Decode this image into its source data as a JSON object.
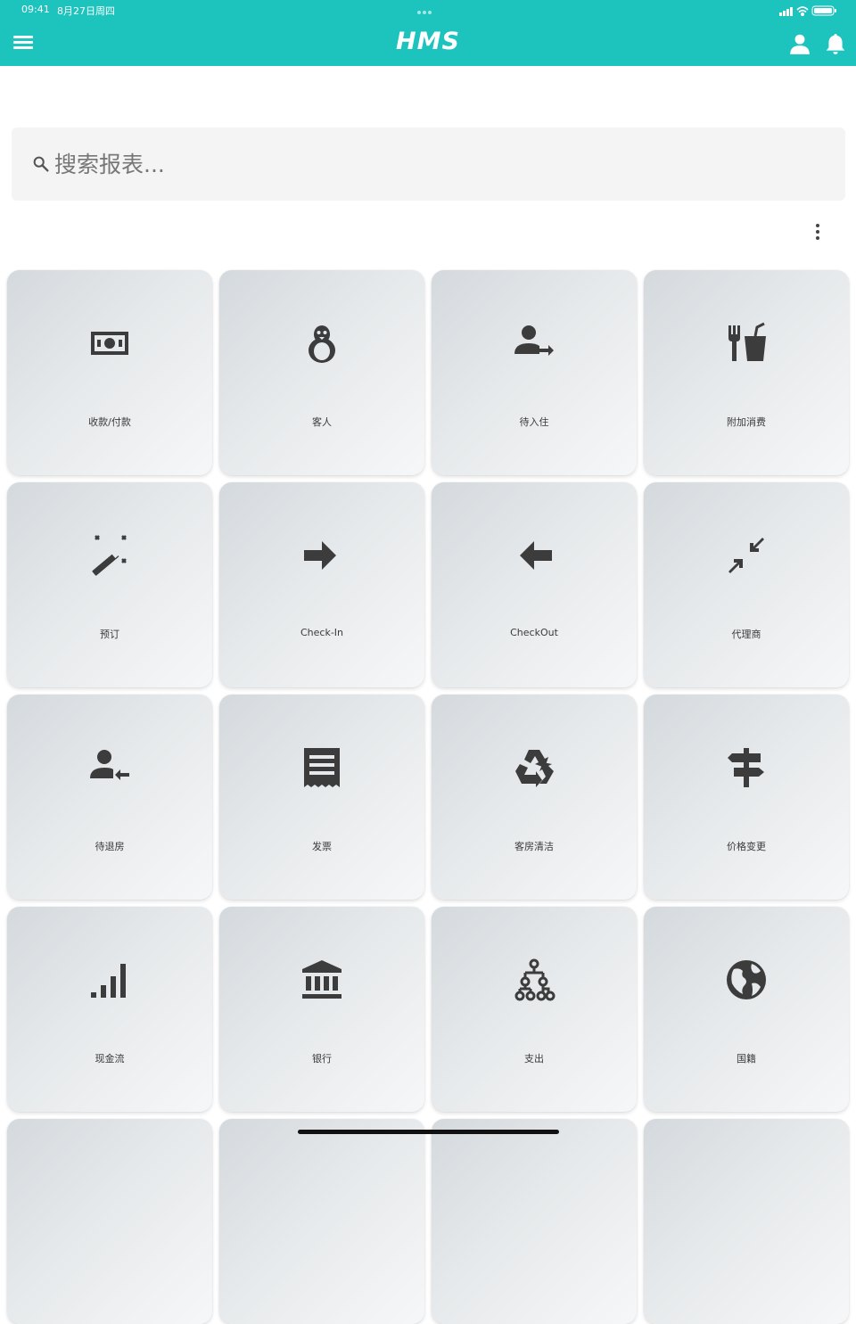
{
  "status_bar": {
    "time": "09:41",
    "date": "8月27日周四"
  },
  "app_bar": {
    "title": "HMS"
  },
  "search": {
    "placeholder": "搜索报表..."
  },
  "tiles": [
    {
      "label": "收款/付款",
      "icon": "money-icon"
    },
    {
      "label": "客人",
      "icon": "penguin-icon"
    },
    {
      "label": "待入住",
      "icon": "person-arrow-right-icon"
    },
    {
      "label": "附加消费",
      "icon": "food-drink-icon"
    },
    {
      "label": "预订",
      "icon": "magic-wand-icon"
    },
    {
      "label": "Check-In",
      "icon": "arrow-right-icon"
    },
    {
      "label": "CheckOut",
      "icon": "arrow-left-icon"
    },
    {
      "label": "代理商",
      "icon": "compress-arrows-icon"
    },
    {
      "label": "待退房",
      "icon": "person-arrow-left-icon"
    },
    {
      "label": "发票",
      "icon": "receipt-icon"
    },
    {
      "label": "客房清洁",
      "icon": "recycle-icon"
    },
    {
      "label": "价格变更",
      "icon": "signpost-icon"
    },
    {
      "label": "现金流",
      "icon": "signal-bars-icon"
    },
    {
      "label": "银行",
      "icon": "bank-icon"
    },
    {
      "label": "支出",
      "icon": "hierarchy-icon"
    },
    {
      "label": "国籍",
      "icon": "globe-icon"
    }
  ],
  "colors": {
    "accent": "#1dc3bd",
    "icon": "#3c3c3c"
  }
}
